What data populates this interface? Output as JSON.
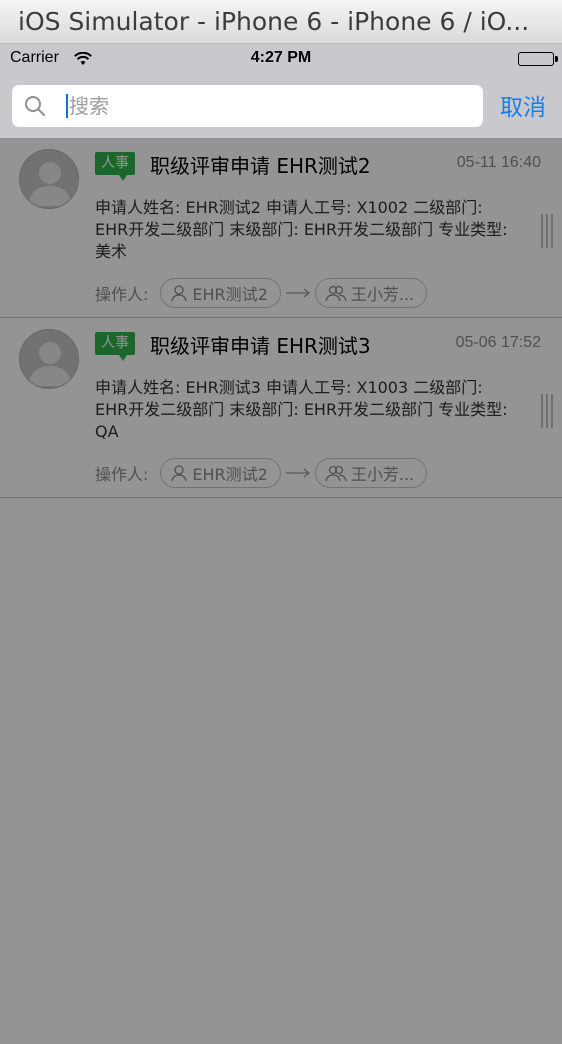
{
  "window": {
    "title": "iOS Simulator - iPhone 6 - iPhone 6 / iO..."
  },
  "status_bar": {
    "carrier": "Carrier",
    "time": "4:27 PM"
  },
  "search": {
    "placeholder": "搜索",
    "value": "",
    "cancel_label": "取消"
  },
  "items": [
    {
      "tag": "人事",
      "title": "职级评审申请 EHR测试2",
      "time": "05-11 16:40",
      "description": "申请人姓名: EHR测试2  申请人工号: X1002  二级部门: EHR开发二级部门  末级部门: EHR开发二级部门  专业类型: 美术",
      "operator_label": "操作人:",
      "operator_from": "EHR测试2",
      "operator_to": "王小芳..."
    },
    {
      "tag": "人事",
      "title": "职级评审申请 EHR测试3",
      "time": "05-06 17:52",
      "description": "申请人姓名: EHR测试3  申请人工号: X1003  二级部门: EHR开发二级部门  末级部门: EHR开发二级部门  专业类型: QA",
      "operator_label": "操作人:",
      "operator_from": "EHR测试2",
      "operator_to": "王小芳..."
    }
  ],
  "colors": {
    "accent": "#1a80e8",
    "tag_green": "#2fb04a",
    "search_bar_bg": "#c8c8cd",
    "overlay": "rgba(0,0,0,0.42)"
  },
  "icons": {
    "search": "search-icon",
    "wifi": "wifi-icon",
    "battery": "battery-icon",
    "person": "person-icon",
    "group": "group-icon",
    "arrow": "arrow-right-icon",
    "reorder": "reorder-handle-icon"
  }
}
